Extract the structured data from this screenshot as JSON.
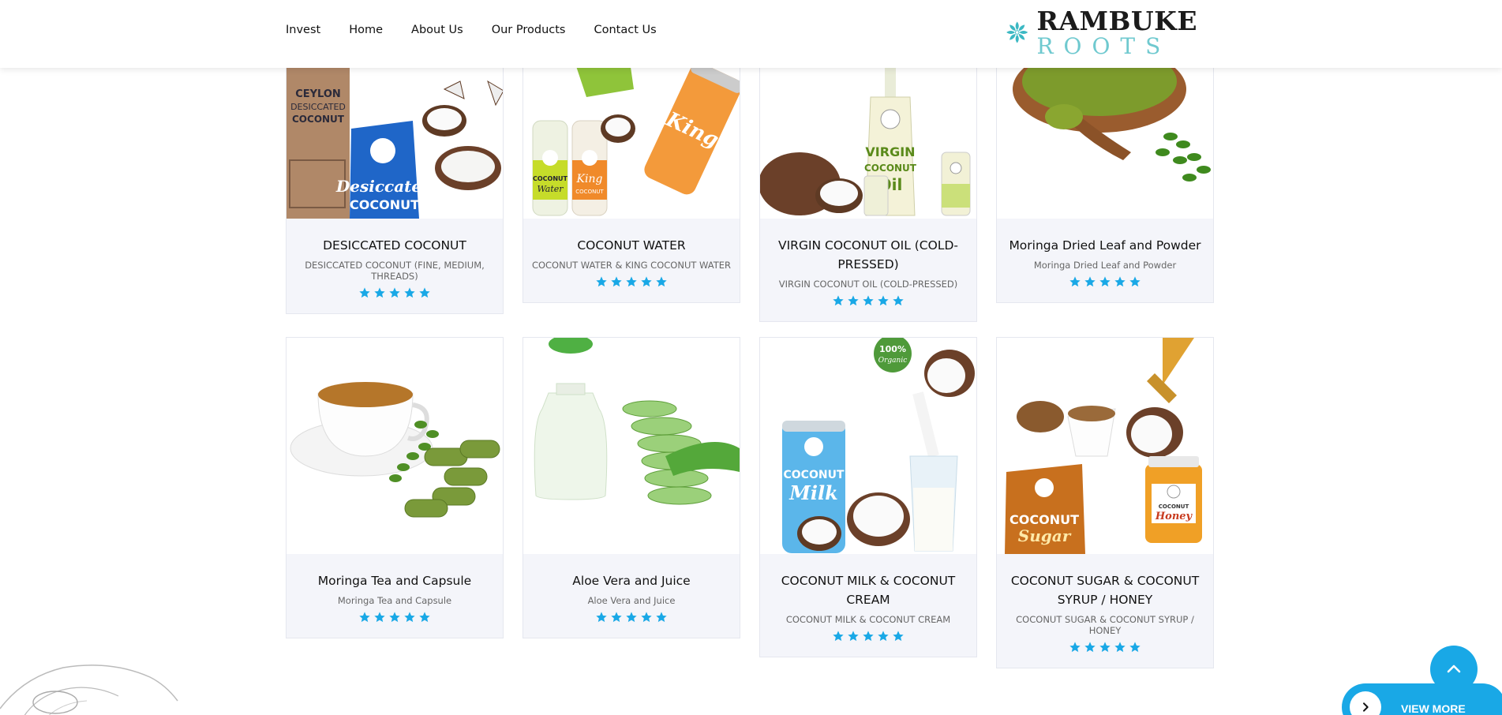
{
  "nav": {
    "items": [
      "Invest",
      "Home",
      "About Us",
      "Our Products",
      "Contact Us"
    ]
  },
  "logo": {
    "line1": "RAMBUKE",
    "line2": "ROOTS"
  },
  "products": [
    {
      "title": "DESICCATED COCONUT",
      "subtitle": "DESICCATED COCONUT (FINE, MEDIUM, THREADS)",
      "rating": 5,
      "image_labels": [
        "CEYLON",
        "DESICCATED",
        "COCONUT",
        "Desiccated",
        "COCONUT"
      ]
    },
    {
      "title": "COCONUT WATER",
      "subtitle": "COCONUT WATER & KING COCONUT WATER",
      "rating": 5,
      "image_labels": [
        "COCONUT",
        "Water",
        "King",
        "COCONUT",
        "King"
      ]
    },
    {
      "title": "VIRGIN COCONUT OIL (COLD-PRESSED)",
      "subtitle": "VIRGIN COCONUT OIL (COLD-PRESSED)",
      "rating": 5,
      "image_labels": [
        "VIRGIN",
        "COCONUT",
        "Oil"
      ]
    },
    {
      "title": "Moringa Dried Leaf and Powder",
      "subtitle": "Moringa Dried Leaf and Powder",
      "rating": 5,
      "image_labels": []
    },
    {
      "title": "Moringa Tea and Capsule",
      "subtitle": "Moringa Tea and Capsule",
      "rating": 5,
      "image_labels": []
    },
    {
      "title": "Aloe Vera and Juice",
      "subtitle": "Aloe Vera and Juice",
      "rating": 5,
      "image_labels": []
    },
    {
      "title": "COCONUT MILK & COCONUT CREAM",
      "subtitle": "COCONUT MILK & COCONUT CREAM",
      "rating": 5,
      "image_labels": [
        "100%",
        "Organic",
        "COCONUT",
        "Milk"
      ]
    },
    {
      "title": "COCONUT SUGAR & COCONUT SYRUP / HONEY",
      "subtitle": "COCONUT SUGAR & COCONUT SYRUP / HONEY",
      "rating": 5,
      "image_labels": [
        "COCONUT",
        "Sugar",
        "COCONUT",
        "Honey"
      ]
    }
  ],
  "buttons": {
    "view_more": "VIEW MORE"
  },
  "colors": {
    "accent": "#19a8e6",
    "star": "#19a8e6",
    "card_bg": "#f4f5fa",
    "logo_teal": "#3bb8c3"
  },
  "icons": {
    "scroll_top": "chevron-up-icon",
    "view_more": "chevron-right-icon",
    "star": "star-icon"
  }
}
